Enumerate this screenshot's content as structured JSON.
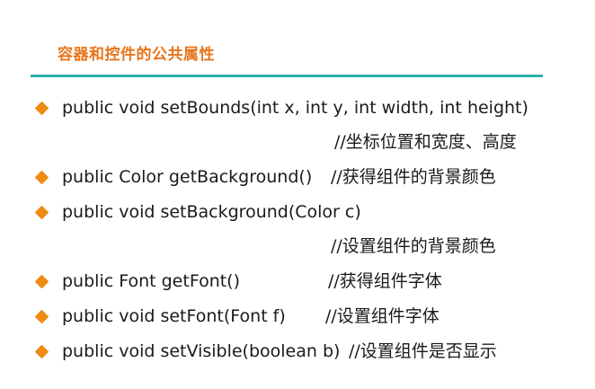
{
  "title": "容器和控件的公共属性",
  "colors": {
    "title": "#e8741a",
    "rule": "#2ab3ad",
    "bullet": "#ef8a12"
  },
  "lines": {
    "l1_code": "public void setBounds(int x, int y, int width, int height)",
    "l1_comment": "//坐标位置和宽度、高度",
    "l2_code": "public Color getBackground()",
    "l2_comment": "//获得组件的背景颜色",
    "l3_code": "public void setBackground(Color c)",
    "l3_comment": "//设置组件的背景颜色",
    "l4_code": "public Font getFont()",
    "l4_comment": "//获得组件字体",
    "l5_code": "public void setFont(Font f)",
    "l5_comment": "//设置组件字体",
    "l6_code": "public void setVisible(boolean b)",
    "l6_comment": "//设置组件是否显示"
  }
}
